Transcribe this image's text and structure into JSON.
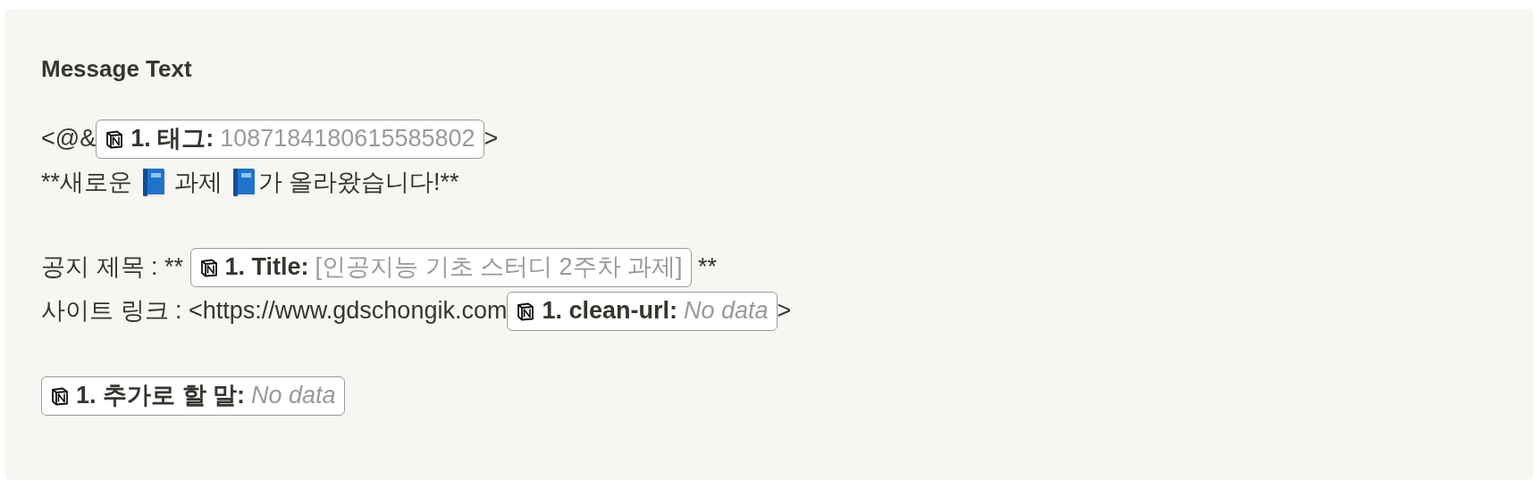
{
  "heading": "Message Text",
  "paragraphs": [
    {
      "lines": [
        {
          "segments": [
            {
              "kind": "text",
              "text": "<@&"
            },
            {
              "kind": "token",
              "label": "1. 태그:",
              "value": "1087184180615585802",
              "empty": false
            },
            {
              "kind": "text",
              "text": ">"
            }
          ]
        },
        {
          "segments": [
            {
              "kind": "text",
              "text": "**새로운 "
            },
            {
              "kind": "book"
            },
            {
              "kind": "text",
              "text": " 과제 "
            },
            {
              "kind": "book"
            },
            {
              "kind": "text",
              "text": "가 올라왔습니다!**"
            }
          ]
        }
      ]
    },
    {
      "lines": [
        {
          "segments": [
            {
              "kind": "text",
              "text": "공지 제목 : ** "
            },
            {
              "kind": "token",
              "label": "1. Title:",
              "value": "[인공지능 기초 스터디 2주차 과제]",
              "empty": false
            },
            {
              "kind": "text",
              "text": " **"
            }
          ]
        },
        {
          "segments": [
            {
              "kind": "text",
              "text": "사이트 링크 : <https://www.gdschongik.com"
            },
            {
              "kind": "token",
              "label": "1. clean-url:",
              "value": "No data",
              "empty": true
            },
            {
              "kind": "text",
              "text": ">"
            }
          ]
        }
      ]
    },
    {
      "lines": [
        {
          "segments": [
            {
              "kind": "token",
              "label": "1. 추가로 할 말:",
              "value": "No data",
              "empty": true
            }
          ]
        }
      ]
    }
  ]
}
